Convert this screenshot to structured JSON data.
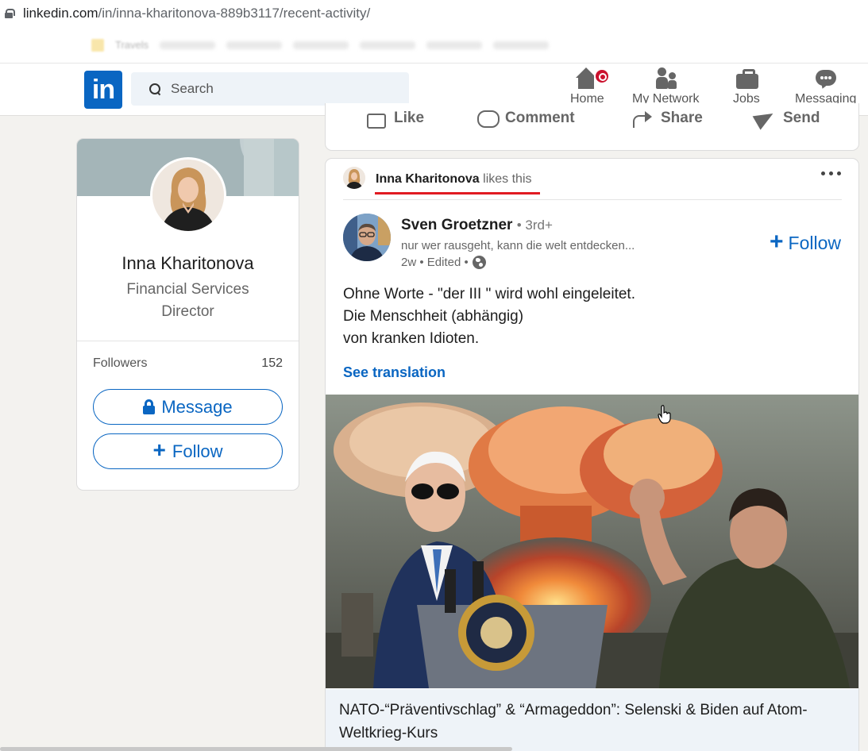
{
  "browser": {
    "url_host": "linkedin.com",
    "url_path": "/in/inna-kharitonova-889b3117/recent-activity/",
    "bookmarks": [
      "Travels"
    ]
  },
  "nav": {
    "logo": "in",
    "search_placeholder": "Search",
    "items": [
      {
        "label": "Home",
        "icon": "home-icon",
        "has_notification": true
      },
      {
        "label": "My Network",
        "icon": "people-icon"
      },
      {
        "label": "Jobs",
        "icon": "briefcase-icon"
      },
      {
        "label": "Messaging",
        "icon": "chat-icon"
      }
    ]
  },
  "profile": {
    "name": "Inna Kharitonova",
    "title": "Financial Services Director",
    "followers_label": "Followers",
    "followers_count": "152",
    "message_button": "Message",
    "follow_button": "Follow"
  },
  "prev_post_actions": [
    "Like",
    "Comment",
    "Share",
    "Send"
  ],
  "post": {
    "liker_name": "Inna Kharitonova",
    "liker_action": "likes this",
    "author": {
      "name": "Sven Groetzner",
      "degree": "• 3rd+",
      "headline": "nur wer rausgeht, kann die welt entdecken...",
      "meta": "2w • Edited •"
    },
    "follow_label": "Follow",
    "text_lines": [
      "Ohne Worte - \"der III \" wird wohl eingeleitet.",
      "Die Menschheit (abhängig)",
      "von kranken Idioten."
    ],
    "see_translation": "See translation",
    "link_title": "NATO-“Präventivschlag” & “Armageddon”: Selenski & Biden auf Atom-Weltkrieg-Kurs"
  },
  "colors": {
    "brand": "#0a66c2",
    "notification": "#cb112d",
    "annotation_underline": "#e11b22"
  }
}
